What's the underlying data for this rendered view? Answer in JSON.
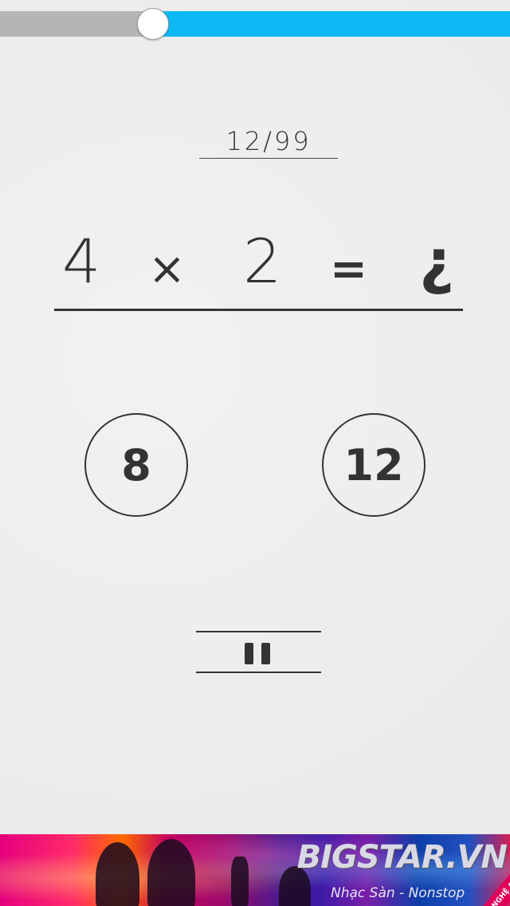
{
  "timer": {
    "progress": 0.3
  },
  "counter": {
    "text": "12/99"
  },
  "equation": {
    "operand_a": "4",
    "operator": "×",
    "operand_b": "2",
    "equals": "=",
    "result_placeholder": "¿"
  },
  "answers": [
    {
      "label": "8"
    },
    {
      "label": "12"
    }
  ],
  "pause": {
    "icon": "pause-icon"
  },
  "banner": {
    "brand": "BIGSTAR.VN",
    "tagline": "Nhạc Sàn - Nonstop",
    "stamp": "TEEN NGHỆ AN"
  },
  "colors": {
    "accent": "#0fb8f5",
    "elapsed": "#b5b5b5",
    "ink": "#333333",
    "background": "#efefef"
  }
}
